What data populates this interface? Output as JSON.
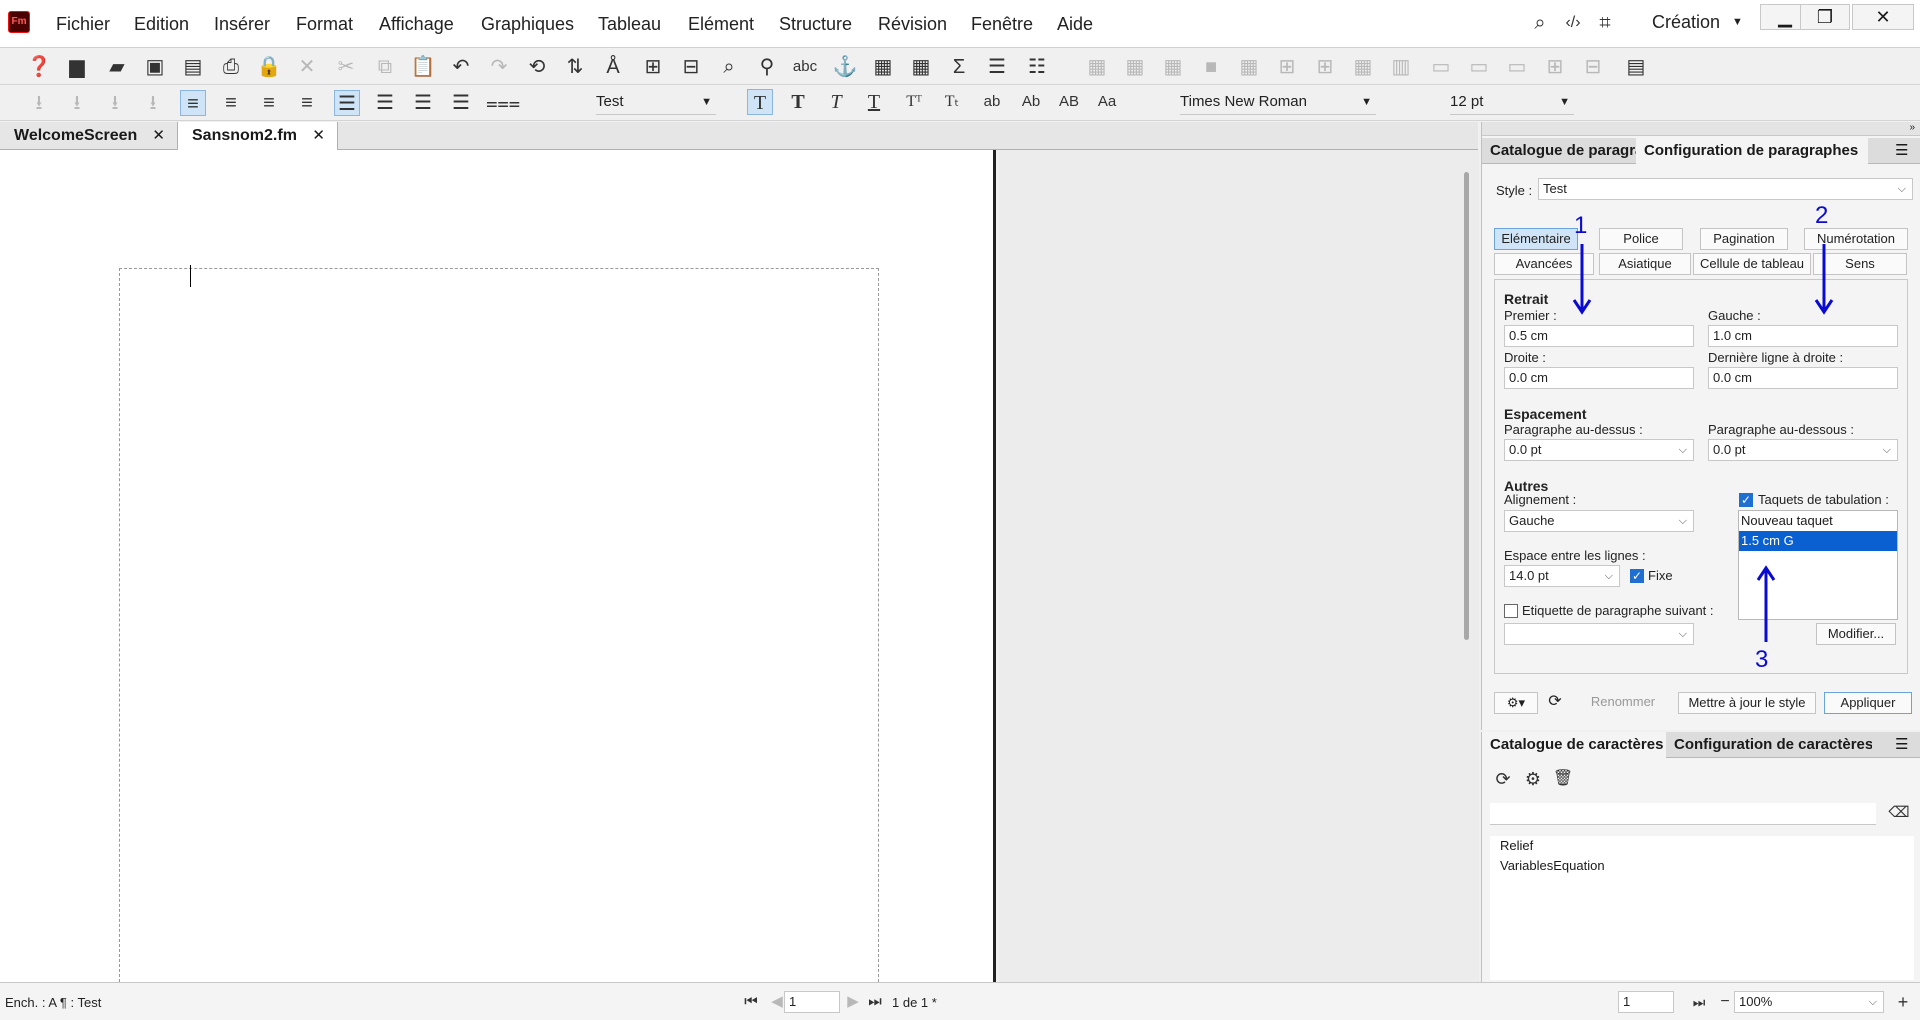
{
  "app": {
    "logo_text": "Fm",
    "workspace": "Création"
  },
  "menu": [
    "Fichier",
    "Edition",
    "Insérer",
    "Format",
    "Affichage",
    "Graphiques",
    "Tableau",
    "Elément",
    "Structure",
    "Révision",
    "Fenêtre",
    "Aide"
  ],
  "format_bar": {
    "paragraph_tag": "Test",
    "font": "Times New Roman",
    "size": "12 pt"
  },
  "tabs": [
    {
      "label": "WelcomeScreen"
    },
    {
      "label": "Sansnom2.fm"
    }
  ],
  "para_panel": {
    "tab_catalog": "Catalogue de paragraphes",
    "tab_config": "Configuration de paragraphes",
    "style_label": "Style :",
    "style_value": "Test",
    "subtabs_row1": [
      "Elémentaire",
      "Police",
      "Pagination",
      "Numérotation"
    ],
    "subtabs_row2": [
      "Avancées",
      "Asiatique",
      "Cellule de tableau",
      "Sens"
    ],
    "retrait": {
      "title": "Retrait",
      "premier_label": "Premier :",
      "premier": "0.5 cm",
      "gauche_label": "Gauche :",
      "gauche": "1.0 cm",
      "droite_label": "Droite :",
      "droite": "0.0 cm",
      "derniere_label": "Dernière ligne à droite :",
      "derniere": "0.0 cm"
    },
    "espacement": {
      "title": "Espacement",
      "dessus_label": "Paragraphe au-dessus :",
      "dessus": "0.0 pt",
      "dessous_label": "Paragraphe au-dessous :",
      "dessous": "0.0 pt"
    },
    "autres": {
      "title": "Autres",
      "alignement_label": "Alignement :",
      "alignement": "Gauche",
      "taquets_label": "Taquets de tabulation :",
      "espace_label": "Espace entre les lignes :",
      "espace": "14.0 pt",
      "fixe_label": "Fixe",
      "suivant_label": "Etiquette de paragraphe suivant :",
      "suivant": ""
    },
    "tab_stops": [
      "Nouveau taquet",
      "1.5 cm  G"
    ],
    "modifier": "Modifier...",
    "renommer": "Renommer",
    "update_style": "Mettre à jour le style",
    "apply": "Appliquer"
  },
  "char_panel": {
    "tab_catalog": "Catalogue de caractères",
    "tab_config": "Configuration de caractères",
    "search_value": "",
    "items": [
      "Relief",
      "VariablesEquation"
    ]
  },
  "annotations": [
    "1",
    "2",
    "3"
  ],
  "status": {
    "left": "Ench. : A ¶ : Test",
    "page_input": "1",
    "page_of": "1 de 1 *",
    "page_input2": "1",
    "zoom": "100%"
  }
}
